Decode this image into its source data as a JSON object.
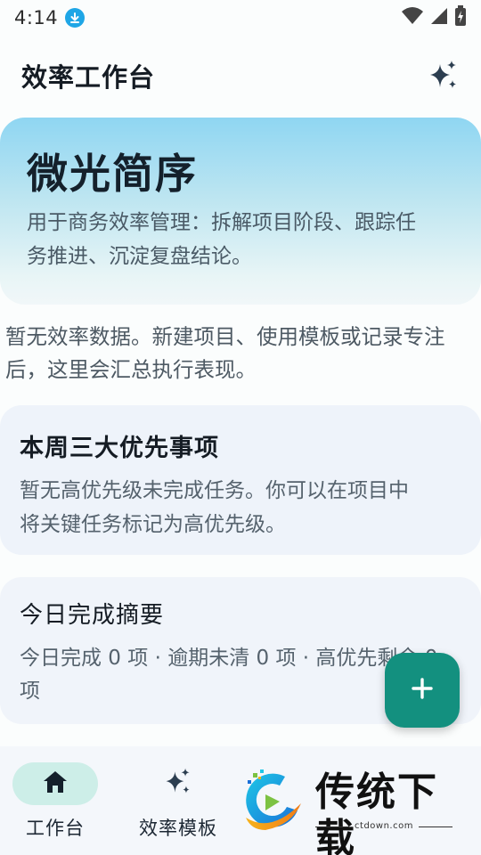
{
  "status_bar": {
    "time": "4:14"
  },
  "header": {
    "title": "效率工作台",
    "action_icon": "sparkle-icon"
  },
  "hero": {
    "title": "微光简序",
    "description_line1": "用于商务效率管理：拆解项目阶段、跟踪任",
    "description_line2": "务推进、沉淀复盘结论。"
  },
  "stats": {
    "empty_line1": "暂无效率数据。新建项目、使用模板或记录专注",
    "empty_line2": "后，这里会汇总执行表现。"
  },
  "priority_card": {
    "title": "本周三大优先事项",
    "desc_line1": "暂无高优先级未完成任务。你可以在项目中",
    "desc_line2": "将关键任务标记为高优先级。"
  },
  "summary_card": {
    "title": "今日完成摘要",
    "text_line1": "今日完成 0 项 · 逾期未清 0 项 · 高优先剩余 0",
    "text_line2": "项"
  },
  "fab": {
    "icon": "plus-icon",
    "color": "#13907f"
  },
  "bottom_nav": {
    "items": [
      {
        "label": "工作台",
        "icon": "home-icon",
        "active": true
      },
      {
        "label": "效率模板",
        "icon": "sparkle-icon",
        "active": false
      }
    ]
  },
  "watermark": {
    "brand": "传统下载",
    "url": "ctdown.com"
  },
  "colors": {
    "accent": "#13907f",
    "active_nav_pill": "#cdeee8",
    "hero_gradient_top": "#8fd6f2",
    "card_background": "#eef3fa"
  }
}
